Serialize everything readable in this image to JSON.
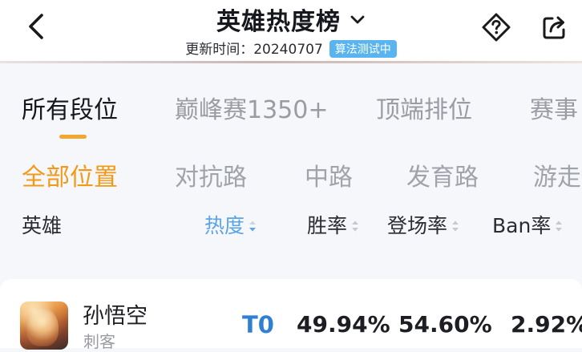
{
  "header": {
    "title": "英雄热度榜",
    "update_label": "更新时间：20240707",
    "tag": "算法测试中"
  },
  "tier_tabs": [
    "所有段位",
    "巅峰赛1350+",
    "顶端排位",
    "赛事"
  ],
  "position_tabs": [
    "全部位置",
    "对抗路",
    "中路",
    "发育路",
    "游走"
  ],
  "columns": {
    "hero": "英雄",
    "heat": "热度",
    "win_rate": "胜率",
    "pick_rate": "登场率",
    "ban_rate": "Ban率"
  },
  "rows": [
    {
      "name": "孙悟空",
      "role": "刺客",
      "tier": "T0",
      "win_rate": "49.94%",
      "pick_rate": "54.60%",
      "ban_rate": "2.92%"
    }
  ],
  "colors": {
    "accent_orange": "#f29a17",
    "underline": "#f3a632",
    "active_sort": "#5aa4e6",
    "tier_blue": "#2f7fd4",
    "tag_blue": "#5ab4ef"
  }
}
